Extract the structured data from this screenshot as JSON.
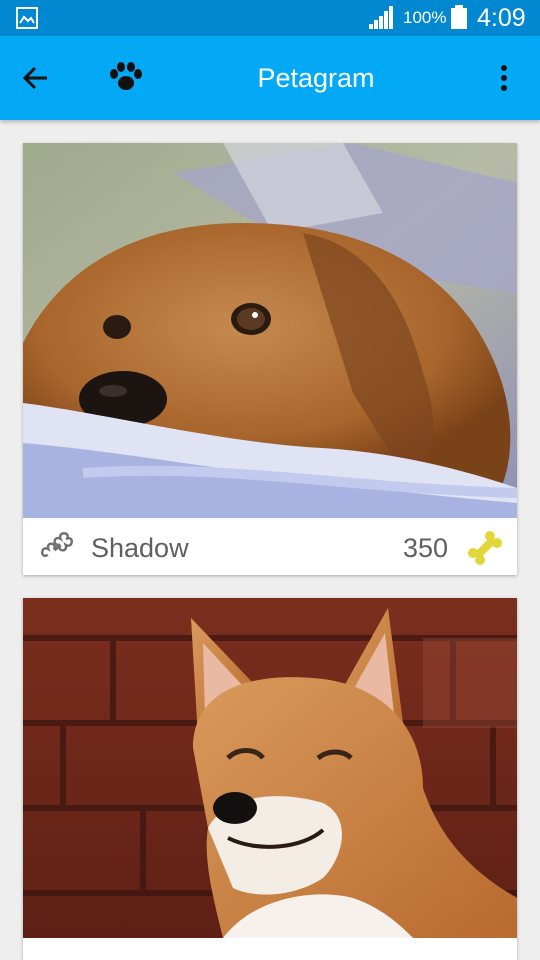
{
  "status_bar": {
    "battery_percent": "100%",
    "time": "4:09",
    "icons": [
      "gallery-icon",
      "signal-icon",
      "battery-icon"
    ]
  },
  "app_bar": {
    "title": "Petagram",
    "icons": [
      "back-arrow-icon",
      "paw-icon",
      "more-vert-icon"
    ]
  },
  "pets": [
    {
      "name": "Shadow",
      "likes": "350",
      "photo": "golden dog resting on bed"
    },
    {
      "name": "",
      "likes": "",
      "photo": "shiba inu in front of brick wall"
    }
  ],
  "colors": {
    "status_bar": "#0288d1",
    "app_bar": "#03a9f4",
    "background": "#eeeeee",
    "bone_like": "#e3d63a",
    "text": "#5f5f5f"
  }
}
